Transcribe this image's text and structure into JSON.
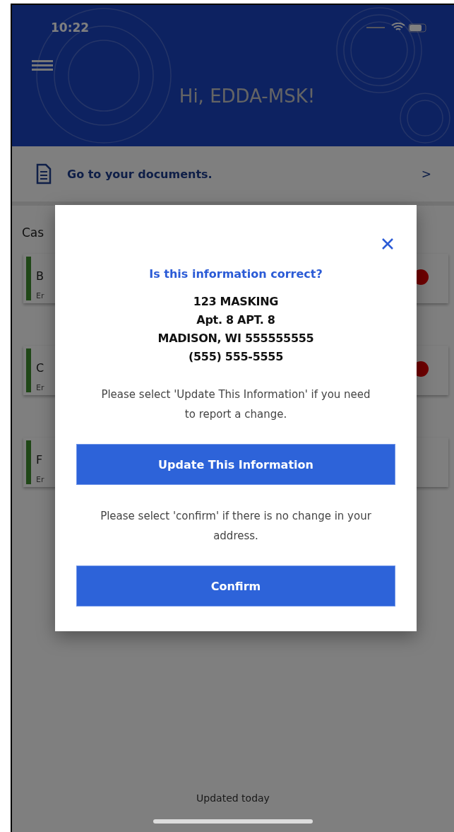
{
  "status_bar": {
    "time": "10:22"
  },
  "header": {
    "greeting": "Hi, EDDA-MSK!"
  },
  "documents_link": {
    "label": "Go to your documents.",
    "chevron": ">"
  },
  "cases": {
    "title": "Cas",
    "items": [
      {
        "title": "B",
        "subtitle": "Er",
        "alert": true
      },
      {
        "title": "C",
        "subtitle": "Er",
        "alert": true
      },
      {
        "title": "F",
        "subtitle": "Er",
        "alert": false
      }
    ]
  },
  "footer": {
    "updated": "Updated today"
  },
  "dialog": {
    "title": "Is this information correct?",
    "address_lines": [
      "123 MASKING",
      "Apt. 8 APT. 8",
      "MADISON, WI 555555555",
      "(555) 555-5555"
    ],
    "update_note": "Please select 'Update This Information' if you need to report a change.",
    "update_button": "Update This Information",
    "confirm_note": "Please select 'confirm' if there is no change in your address.",
    "confirm_button": "Confirm"
  }
}
